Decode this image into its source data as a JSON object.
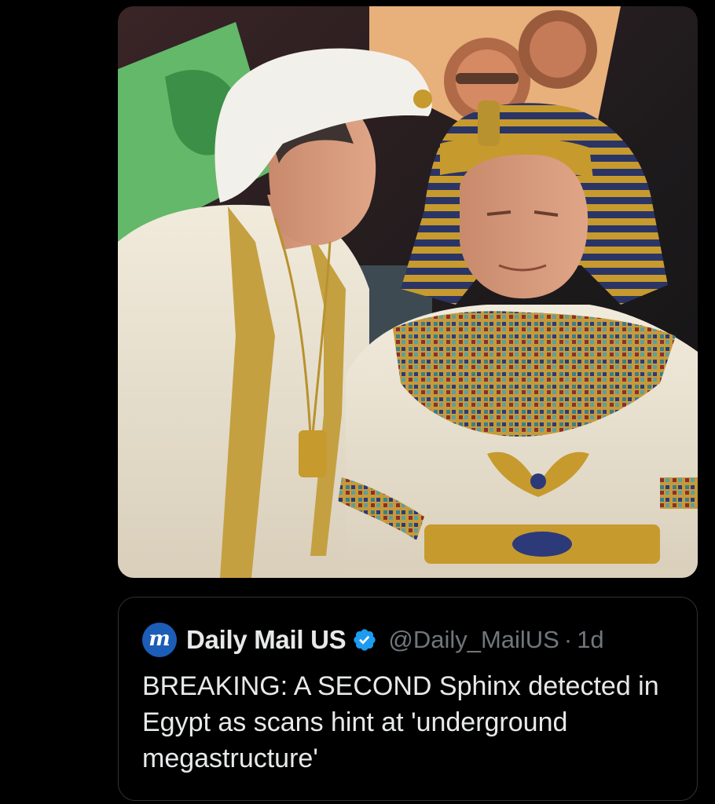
{
  "media": {
    "alt_icon": "photo"
  },
  "quoted_post": {
    "avatar_letter": "m",
    "display_name": "Daily Mail US",
    "verified": true,
    "handle": "@Daily_MailUS",
    "separator": "·",
    "time": "1d",
    "text": "BREAKING: A SECOND Sphinx detected in Egypt as scans hint at 'underground megastructure'"
  },
  "colors": {
    "background": "#000000",
    "primary_text": "#e7e9ea",
    "secondary_text": "#71767b",
    "border": "#2f3336",
    "verified": "#1d9bf0",
    "avatar": "#1c5db8"
  }
}
